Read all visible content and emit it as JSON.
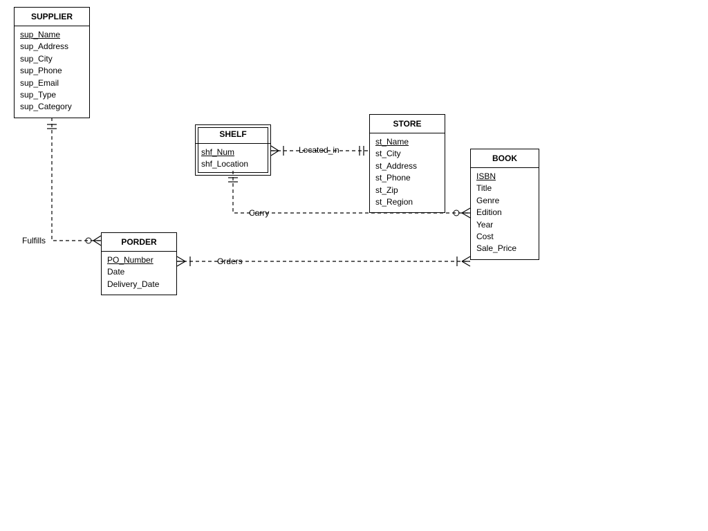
{
  "entities": {
    "supplier": {
      "title": "SUPPLIER",
      "attrs": [
        "sup_Name",
        "sup_Address",
        "sup_City",
        "sup_Phone",
        "sup_Email",
        "sup_Type",
        "sup_Category"
      ],
      "pk": [
        "sup_Name"
      ]
    },
    "shelf": {
      "title": "SHELF",
      "attrs": [
        "shf_Num",
        "shf_Location"
      ],
      "pk": [
        "shf_Num"
      ]
    },
    "store": {
      "title": "STORE",
      "attrs": [
        "st_Name",
        "st_City",
        "st_Address",
        "st_Phone",
        "st_Zip",
        "st_Region"
      ],
      "pk": [
        "st_Name"
      ]
    },
    "book": {
      "title": "BOOK",
      "attrs": [
        "ISBN",
        "Title",
        "Genre",
        "Edition",
        "Year",
        "Cost",
        "Sale_Price"
      ],
      "pk": [
        "ISBN"
      ]
    },
    "porder": {
      "title": "PORDER",
      "attrs": [
        "PO_Number",
        "Date",
        "Delivery_Date"
      ],
      "pk": [
        "PO_Number"
      ]
    }
  },
  "relationships": {
    "fulfills": "Fulfills",
    "located_in": "Located_in",
    "carry": "Carry",
    "orders": "Orders"
  }
}
